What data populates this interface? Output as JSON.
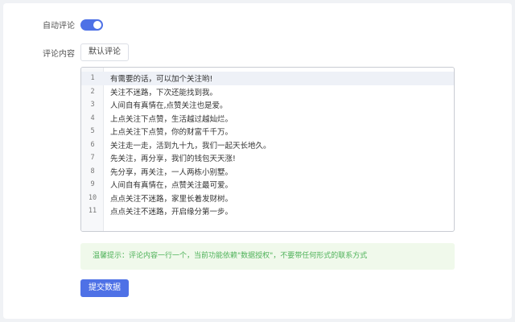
{
  "form": {
    "auto_comment_label": "自动评论",
    "auto_comment_enabled": true,
    "content_label": "评论内容",
    "default_button": "默认评论",
    "comment_lines": [
      "有需要的话，可以加个关注哟!",
      "关注不迷路，下次还能找到我。",
      "人间自有真情在,点赞关注也是爱。",
      "上点关注下点赞，生活越过越灿烂。",
      "上点关注下点赞，你的财富千千万。",
      "关注走一走，活到九十九，我们一起天长地久。",
      "先关注，再分享，我们的钱包天天涨!",
      "先分享，再关注，一人两栋小别墅。",
      "人间自有真情在，点赞关注最可爱。",
      "点点关注不迷路，家里长着发财树。",
      "点点关注不迷路，开启缘分第一步。"
    ],
    "tip": "温馨提示：评论内容一行一个，当前功能依赖\"数据授权\"，不要带任何形式的联系方式",
    "submit_button": "提交数据"
  },
  "colors": {
    "accent": "#4e71e6",
    "tip_bg": "#f0f9eb",
    "tip_text": "#4fb25a"
  }
}
